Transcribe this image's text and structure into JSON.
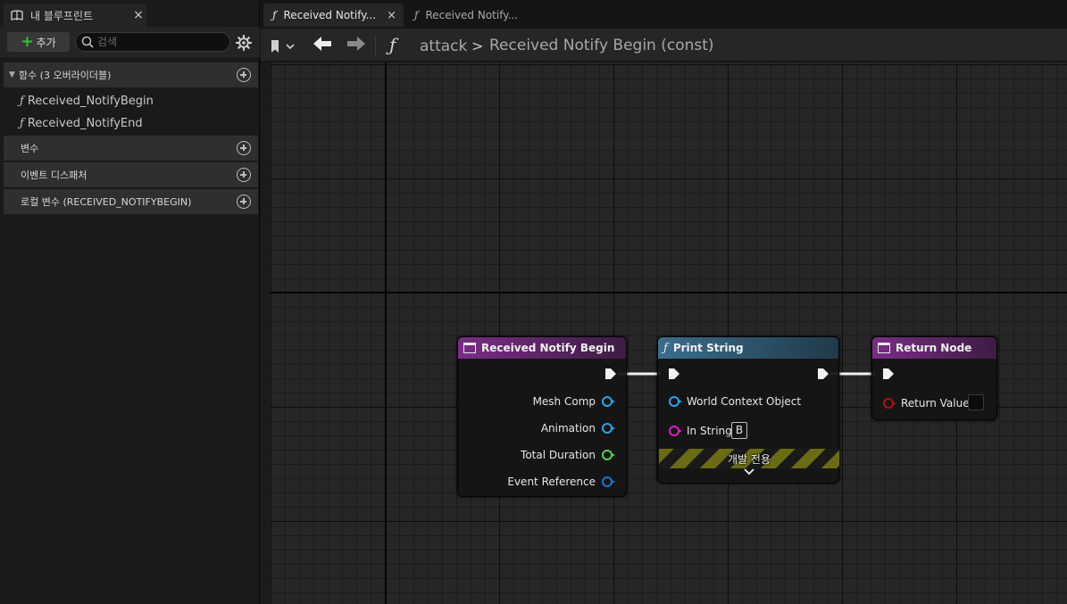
{
  "left_panel": {
    "tab_label": "내 블루프린트",
    "tab_close": "×",
    "add_label": "추가",
    "search_placeholder": "검색",
    "sections": {
      "functions": "함수 (3 오버라이더블)",
      "variables": "변수",
      "event_dispatchers": "이벤트 디스패처",
      "local_variables": "로컬 변수 (RECEIVED_NOTIFYBEGIN)"
    },
    "functions": [
      {
        "label": "Received_NotifyBegin",
        "icon": "function-icon"
      },
      {
        "label": "Received_NotifyEnd",
        "icon": "function-icon"
      }
    ]
  },
  "tabs": [
    {
      "label": "Received Notify...",
      "active": true,
      "close": "×"
    },
    {
      "label": "Received Notify...",
      "active": false
    }
  ],
  "toolbar": {
    "breadcrumb_root": "attack",
    "breadcrumb_separator": ">",
    "breadcrumb_current": "Received Notify Begin (const)"
  },
  "graph": {
    "nodes": {
      "received_notify_begin": {
        "title": "Received Notify Begin",
        "outputs": [
          "Mesh Comp",
          "Animation",
          "Total Duration",
          "Event Reference"
        ]
      },
      "print_string": {
        "title": "Print String",
        "inputs": [
          "World Context Object",
          "In String"
        ],
        "in_string_value": "B",
        "dev_only_label": "개발 전용"
      },
      "return_node": {
        "title": "Return Node",
        "inputs": [
          "Return Value"
        ]
      }
    },
    "colors": {
      "node_header_purple": "#7a2d86",
      "node_header_blue": "#3b6d8c",
      "pin_object": "#2aa4e6",
      "pin_float": "#4fd24a",
      "pin_struct": "#1b74d6",
      "pin_string": "#e21ac8",
      "pin_bool": "#b01010",
      "add_plus": "#36c23a"
    }
  }
}
